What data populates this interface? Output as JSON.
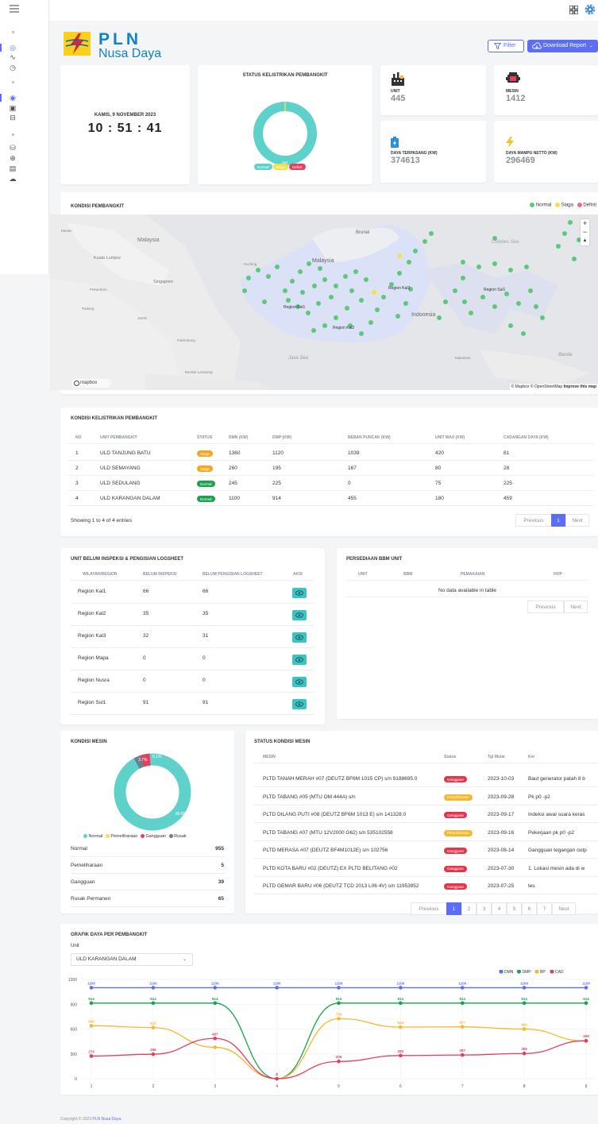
{
  "header": {
    "logo_title": "PLN",
    "logo_subtitle": "Nusa Daya",
    "filter_label": "Filter",
    "download_label": "Download Report"
  },
  "clock": {
    "date": "KAMIS, 9 NOVEMBER 2023",
    "time": "10 : 51 : 41"
  },
  "status_card": {
    "title": "STATUS KELISTRIKAN PEMBANGKIT",
    "center_value": "441",
    "legend": [
      "Normal",
      "Siaga",
      "Defisit"
    ]
  },
  "stats": [
    {
      "label": "UNIT",
      "value": "445"
    },
    {
      "label": "MESIN",
      "value": "1412"
    },
    {
      "label": "DAYA TERPASANG (KW)",
      "value": "374613"
    },
    {
      "label": "DAYA MAMPU NETTO (KW)",
      "value": "296469"
    }
  ],
  "map": {
    "title": "KONDISI PEMBANGKIT",
    "legend": [
      "Normal",
      "Siaga",
      "Defisit"
    ],
    "labels": {
      "malaysia1": "Malaysia",
      "malaysia2": "Malaysia",
      "brunei": "Brunei",
      "kl": "Kuala Lumpur",
      "singapore": "Singapore",
      "indonesia": "Indonesia",
      "kal1": "Region Kal1",
      "kal2": "Region Kal2",
      "kal3": "Region Kal3",
      "sul1": "Region Sul1",
      "java": "Java Sea",
      "celebes": "Celebes Sea",
      "banda": "Banda",
      "medan": "Medan",
      "pekanbaru": "Pekanbaru",
      "padang": "Padang",
      "jambi": "Jambi",
      "palembang": "Palembang",
      "bandar": "Bandar Lampung",
      "makassar": "Makassar",
      "kuching": "Kuching"
    },
    "attribution": "© Mapbox © OpenStreetMap",
    "improve": "Improve this map",
    "mapbox_logo": "mapbox",
    "zoom_in": "+",
    "zoom_out": "−"
  },
  "kelistrikan": {
    "title": "KONDISI KELISTRIKAN PEMBANGKIT",
    "headers": [
      "NO",
      "UNIT PEMBANGKIT",
      "STATUS",
      "DMN (KW)",
      "DMP (KW)",
      "BEBAN PUNCAK (KW)",
      "UNIT MAX (KW)",
      "CADANGAN DAYA (KW)"
    ],
    "rows": [
      {
        "no": "1",
        "unit": "ULD TANJUNG BATU",
        "status": "Siaga",
        "dmn": "1360",
        "dmp": "1120",
        "beban": "1039",
        "max": "420",
        "cad": "81"
      },
      {
        "no": "2",
        "unit": "ULD SEMAYANG",
        "status": "Siaga",
        "dmn": "260",
        "dmp": "195",
        "beban": "167",
        "max": "80",
        "cad": "28"
      },
      {
        "no": "3",
        "unit": "ULD SEDULANG",
        "status": "Normal",
        "dmn": "245",
        "dmp": "225",
        "beban": "0",
        "max": "75",
        "cad": "225"
      },
      {
        "no": "4",
        "unit": "ULD KARANGAN DALAM",
        "status": "Normal",
        "dmn": "1100",
        "dmp": "914",
        "beban": "455",
        "max": "180",
        "cad": "459"
      }
    ],
    "info": "Showing 1 to 4 of 4 entries",
    "pager": {
      "prev": "Previous",
      "page": "1",
      "next": "Next"
    }
  },
  "inspeksi": {
    "title": "UNIT BELUM INSPEKSI & PENGISIAN LOGSHEET",
    "headers": [
      "WILAYAH/REGION",
      "BELUM INSPEKSI",
      "BELUM PENGISIAN LOGSHEET",
      "AKSI"
    ],
    "rows": [
      {
        "region": "Region Kal1",
        "inspeksi": "66",
        "logsheet": "66"
      },
      {
        "region": "Region Kal2",
        "inspeksi": "35",
        "logsheet": "35"
      },
      {
        "region": "Region Kal3",
        "inspeksi": "32",
        "logsheet": "31"
      },
      {
        "region": "Region Mapa",
        "inspeksi": "0",
        "logsheet": "0"
      },
      {
        "region": "Region Nusra",
        "inspeksi": "0",
        "logsheet": "0"
      },
      {
        "region": "Region Sul1",
        "inspeksi": "91",
        "logsheet": "91"
      }
    ]
  },
  "bbm": {
    "title": "PERSEDIAAN BBM UNIT",
    "headers": [
      "UNIT",
      "BBM",
      "PEMAKAIAN",
      "HOP"
    ],
    "empty": "No data available in table",
    "pager": {
      "prev": "Previous",
      "next": "Next"
    }
  },
  "kondisi_mesin": {
    "title": "KONDISI MESIN",
    "labels": {
      "normal_pct": "89.8%",
      "pemeliharaan_pct": "",
      "gangguan_pct": "3.7%",
      "rusak_pct": "6.1%"
    },
    "legend": [
      "Normal",
      "Pemeliharaan",
      "Gangguan",
      "Rusak"
    ],
    "list": [
      {
        "label": "Normal",
        "value": "955"
      },
      {
        "label": "Pemeliharaan",
        "value": "5"
      },
      {
        "label": "Gangguan",
        "value": "39"
      },
      {
        "label": "Rusak Permanen",
        "value": "65"
      }
    ]
  },
  "status_mesin": {
    "title": "STATUS KONDISI MESIN",
    "headers": [
      "MESIN",
      "Status",
      "Tgl Mulai",
      "Ket"
    ],
    "rows": [
      {
        "mesin": "PLTD TANAH MERAH #07 (DEUTZ BF6M 1015 CP) s/n 9188695.0",
        "status": "Gangguan",
        "tgl": "2023-10-03",
        "ket": "Baut generator patah 8 b"
      },
      {
        "mesin": "PLTD TABANG #05 (MTU OM 444A) s/n",
        "status": "Pemeliharaan",
        "tgl": "2023-09-28",
        "ket": "Pk p0 -p2"
      },
      {
        "mesin": "PLTD DILANG PUTI #08 (DEUTZ BF6M 1013 E) s/n 141328.0",
        "status": "Gangguan",
        "tgl": "2023-09-17",
        "ket": "Indeksi awal suara keras"
      },
      {
        "mesin": "PLTD TABANG #07 (MTU 12V2000 G62) s/n 535102558",
        "status": "Pemeliharaan",
        "tgl": "2023-09-16",
        "ket": "Pekerjaan pk p0 -p2"
      },
      {
        "mesin": "PLTD MERASA #07 (DEUTZ BF4M1012E) s/n 102756",
        "status": "Gangguan",
        "tgl": "2023-08-14",
        "ket": "Gangguan tegangan outp"
      },
      {
        "mesin": "PLTD KOTA BARU #02 (DEUTZ) EX PLTD BELITANG #02",
        "status": "Gangguan",
        "tgl": "2023-07-30",
        "ket": "1. Lokasi mesin ada di w"
      },
      {
        "mesin": "PLTD GEMAR BARU #06 (DEUTZ TCD 2013 L06 4V) s/n 11953952",
        "status": "Gangguan",
        "tgl": "2023-07-25",
        "ket": "tes"
      }
    ],
    "pager": {
      "prev": "Previous",
      "pages": [
        "1",
        "2",
        "3",
        "4",
        "5",
        "6",
        "7"
      ],
      "next": "Next"
    }
  },
  "grafik": {
    "title": "GRAFIK DAYA PER PEMBANGKIT",
    "unit_label": "Unit",
    "selected_unit": "ULD KARANGAN DALAM"
  },
  "chart_data": {
    "type": "line",
    "title": "",
    "xlabel": "",
    "ylabel": "",
    "x": [
      1,
      2,
      3,
      4,
      5,
      6,
      7,
      8,
      9
    ],
    "ylim": [
      0,
      1200
    ],
    "yticks": [
      0,
      300,
      600,
      900,
      1200
    ],
    "legend_position": "top-right",
    "series": [
      {
        "name": "DMN",
        "color": "#5b6ef5",
        "values": [
          1100,
          1100,
          1100,
          1100,
          1100,
          1100,
          1100,
          1100,
          1100
        ],
        "labels": [
          "1100",
          "1100",
          "1100",
          "1100",
          "1100",
          "1100",
          "1100",
          "1100",
          "1100"
        ]
      },
      {
        "name": "DMP",
        "color": "#1aa34a",
        "values": [
          914,
          914,
          914,
          0,
          914,
          914,
          914,
          914,
          914
        ],
        "labels": [
          "914",
          "914",
          "914",
          "0",
          "914",
          "914",
          "914",
          "914",
          "914"
        ]
      },
      {
        "name": "BP",
        "color": "#f5b82e",
        "values": [
          640,
          618,
          380,
          0,
          726,
          624,
          627,
          600,
          455
        ],
        "labels": [
          "640",
          "618",
          "",
          "0",
          "726",
          "624",
          "627",
          "600",
          ""
        ]
      },
      {
        "name": "CAD",
        "color": "#e83e5e",
        "values": [
          274,
          296,
          487,
          0,
          209,
          280,
          287,
          305,
          459
        ],
        "labels": [
          "274",
          "296",
          "487",
          "0",
          "209",
          "280",
          "287",
          "305",
          "459"
        ]
      }
    ]
  },
  "footer": {
    "copyright": "Copyright © 2023",
    "company": "PLN Nusa Daya."
  }
}
